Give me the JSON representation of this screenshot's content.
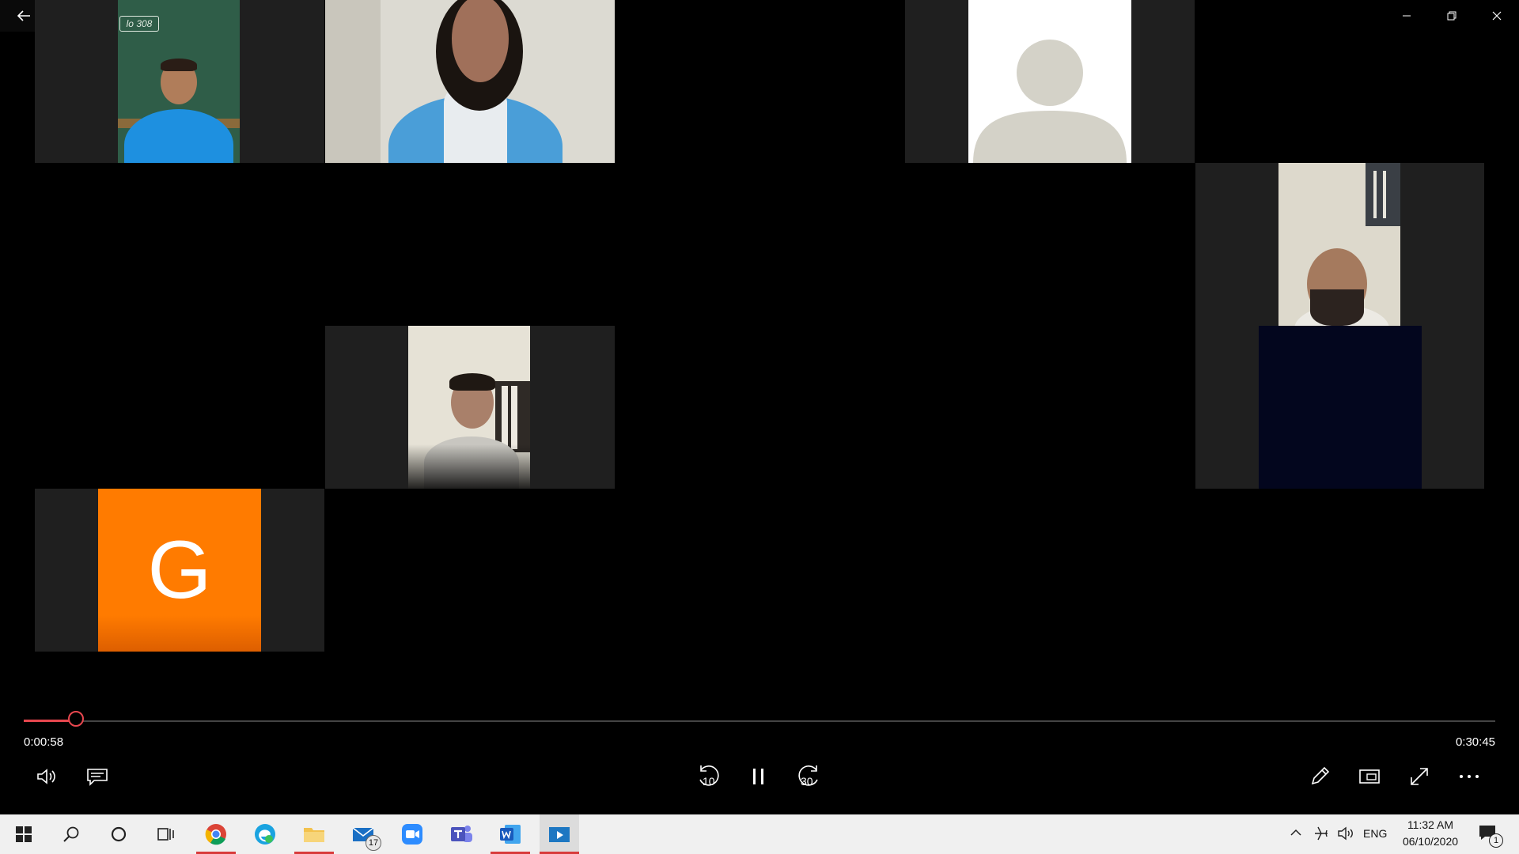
{
  "player": {
    "current_time": "0:00:58",
    "total_time": "0:30:45",
    "progress": 0.031,
    "skip_back_seconds": "10",
    "skip_forward_seconds": "30"
  },
  "participants": {
    "avatar_letter": "G",
    "avatar_color": "#ff7b00",
    "board_text": "lo 308"
  },
  "taskbar": {
    "mail_badge": "17",
    "language": "ENG",
    "time": "11:32 AM",
    "date": "06/10/2020",
    "notification_count": "1"
  },
  "colors": {
    "accent": "#e8474f",
    "background": "#000000",
    "tile_bg": "#1f1f1f",
    "taskbar_bg": "#f0f0f0"
  }
}
